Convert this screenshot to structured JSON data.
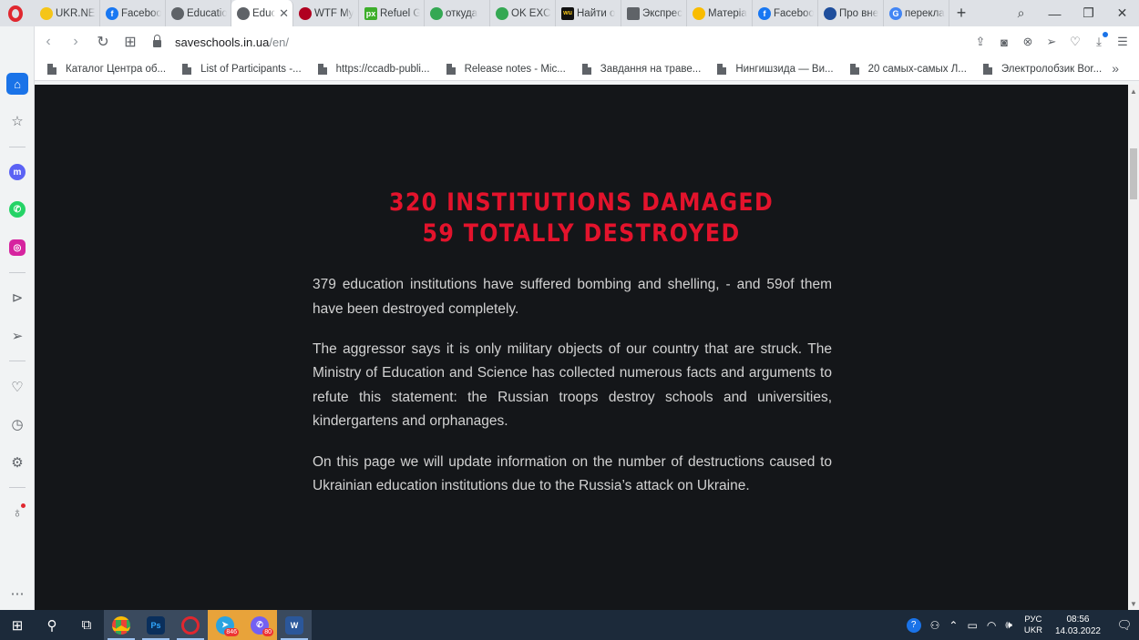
{
  "browser": {
    "tabs": [
      {
        "title": "UKR.NET",
        "favicon_color": "#f5c518",
        "active": false
      },
      {
        "title": "Facebook",
        "favicon_color": "#1877f2",
        "active": false
      },
      {
        "title": "Education",
        "favicon_color": "#5f6368",
        "active": false
      },
      {
        "title": "Educ",
        "favicon_color": "#5f6368",
        "active": true
      },
      {
        "title": "WTF My",
        "favicon_color": "#b00020",
        "active": false
      },
      {
        "title": "Refuel G",
        "favicon_color": "#3dae2b",
        "active": false
      },
      {
        "title": "откуда",
        "favicon_color": "#34a853",
        "active": false
      },
      {
        "title": "OK EXCH",
        "favicon_color": "#34a853",
        "active": false
      },
      {
        "title": "Найти о",
        "favicon_color": "#111111",
        "active": false
      },
      {
        "title": "Экспрес",
        "favicon_color": "#5f6368",
        "active": false
      },
      {
        "title": "Матеріа",
        "favicon_color": "#f9bc00",
        "active": false
      },
      {
        "title": "Facebook",
        "favicon_color": "#1877f2",
        "active": false
      },
      {
        "title": "Про вне",
        "favicon_color": "#1f4e9c",
        "active": false
      },
      {
        "title": "перекла",
        "favicon_color": "#4285f4",
        "active": false
      }
    ],
    "address": {
      "domain": "saveschools.in.ua",
      "path": "/en/"
    },
    "bookmarks": [
      "Каталог Центра об...",
      "List of Participants -...",
      "https://ccadb-publi...",
      "Release notes - Mic...",
      "Завдання на траве...",
      "Нингишзида — Ви...",
      "20 самых-самых Л...",
      "Электролобзик Bor..."
    ]
  },
  "page": {
    "headline_line1": "320 INSTITUTIONS DAMAGED",
    "headline_line2": "59 TOTALLY DESTROYED",
    "paragraph1": "379 education institutions have suffered bombing and shelling, - and 59of them have been destroyed completely.",
    "paragraph2": "The aggressor says it is only military objects of our country that are struck. The Ministry of Education and Science has collected numerous facts and arguments to refute this statement: the Russian troops destroy schools and universities, kindergartens and orphanages.",
    "paragraph3": "On this page we will update information on the number of destructions caused to Ukrainian education institutions due to the Russia’s attack on Ukraine."
  },
  "taskbar": {
    "telegram_badge": "846",
    "viber_badge": "80",
    "input_lang": "РУС",
    "kbd_layout": "UKR",
    "time": "08:56",
    "date": "14.03.2022"
  },
  "colors": {
    "headline": "#e3132c",
    "page_bg": "#141619",
    "body_text": "#d2d2d2",
    "taskbar_bg": "#1c2a3a"
  }
}
